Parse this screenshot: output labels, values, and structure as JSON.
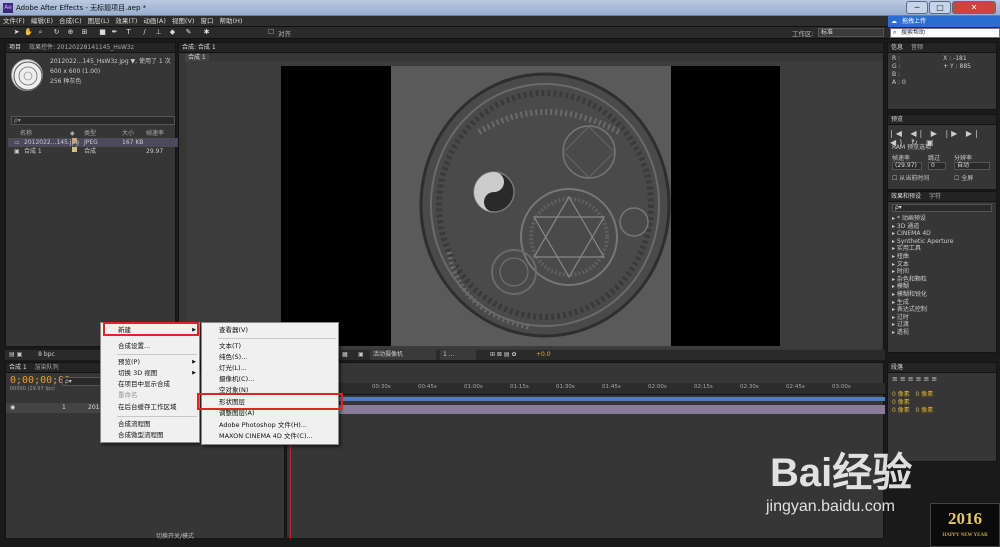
{
  "window": {
    "title": "Adobe After Effects - 无标题项目.aep *",
    "app_icon": "Ae",
    "minimize": "─",
    "maximize": "□",
    "close": "✕"
  },
  "menu": [
    "文件(F)",
    "编辑(E)",
    "合成(C)",
    "图层(L)",
    "效果(T)",
    "动画(A)",
    "视图(V)",
    "窗口",
    "帮助(H)"
  ],
  "upload_button": "拖拽上传",
  "toolbar": {
    "align_label": "对齐",
    "workspace_label": "工作区:",
    "workspace_value": "标准",
    "search_help": "搜索帮助"
  },
  "project": {
    "tab": "项目",
    "effects_tab": "效果控件: 20120228141145_HsW3z",
    "file_name": "2012022...145_HsW3z.jpg",
    "used": "▼, 使用了 1 次",
    "dims": "600 x 600 (1.00)",
    "colors": "256 种灰色",
    "search_placeholder": "ρ▾",
    "columns": [
      "名称",
      "类型",
      "大小",
      "帧速率"
    ],
    "rows": [
      {
        "name": "2012022...145.jpg",
        "type": "JPEG",
        "size": "167 KB",
        "fps": "",
        "color": "#c8a878"
      },
      {
        "name": "合成 1",
        "type": "合成",
        "size": "",
        "fps": "29.97",
        "color": "#d0c080"
      }
    ],
    "bpc": "8 bpc"
  },
  "viewer": {
    "tab": "合成: 合成 1",
    "sub_tab": "合成 1",
    "camera": "活动摄像机",
    "views": "1 ...",
    "exposure": "+0.0"
  },
  "timeline": {
    "tab": "合成 1",
    "render_tab": "渲染队列",
    "timecode": "0;00;00;00",
    "fps_note": "00000 (29.97 fps)",
    "search_placeholder": "ρ▾",
    "layer_index": "1",
    "layer_name": "2012",
    "ruler": [
      "00:30s",
      "00:45s",
      "01:00s",
      "01:15s",
      "01:30s",
      "01:45s",
      "02:00s",
      "02:15s",
      "02:30s",
      "02:45s",
      "03:00s"
    ],
    "footer": "切换开关/模式"
  },
  "info": {
    "tab1": "信息",
    "tab2": "音频",
    "rgba": [
      "R :",
      "G :",
      "B :",
      "A : 0"
    ],
    "x": "X : -181",
    "y": "+ Y : 885"
  },
  "preview": {
    "tab": "预览",
    "controls": "|◀ ◀| ▶ |▶ ▶| ◀) ↻ ▣",
    "ram": "RAM 预览选项",
    "frame_rate_label": "帧速率",
    "skip_label": "跳过",
    "resolution_label": "分辨率",
    "frame_rate": "(29.97)",
    "skip": "0",
    "resolution": "自动",
    "from_current": "从当前时间",
    "fullscreen": "全屏"
  },
  "effects": {
    "tab": "效果和预设",
    "tab2": "字符",
    "search_placeholder": "ρ▾",
    "items": [
      "* 动画预设",
      "3D 通道",
      "CINEMA 4D",
      "Synthetic Aperture",
      "实用工具",
      "扭曲",
      "文本",
      "时间",
      "杂色和颗粒",
      "模糊",
      "模糊和锐化",
      "生成",
      "表达式控制",
      "过时",
      "过渡",
      "透视"
    ]
  },
  "paragraph": {
    "tab": "段落",
    "px": [
      "0 像素",
      "0 像素",
      "0 像素",
      "0 像素",
      "0 像素"
    ]
  },
  "context_menu": {
    "items": [
      {
        "label": "新建",
        "submenu": true,
        "disabled": false
      },
      {
        "label": "合成设置...",
        "submenu": false,
        "disabled": false
      },
      {
        "label": "预览(P)",
        "submenu": true,
        "disabled": false
      },
      {
        "label": "切换 3D 视图",
        "submenu": true,
        "disabled": false
      },
      {
        "label": "在项目中显示合成",
        "submenu": false,
        "disabled": false
      },
      {
        "label": "重命名",
        "submenu": false,
        "disabled": true
      },
      {
        "label": "在后台缓存工作区域",
        "submenu": false,
        "disabled": false
      },
      {
        "label": "合成流程图",
        "submenu": false,
        "disabled": false
      },
      {
        "label": "合成微型流程图",
        "submenu": false,
        "disabled": false
      }
    ]
  },
  "submenu": {
    "items": [
      "查看器(V)",
      "文本(T)",
      "纯色(S)...",
      "灯光(L)...",
      "摄像机(C)...",
      "空对象(N)",
      "形状图层",
      "调整图层(A)",
      "Adobe Photoshop 文件(H)...",
      "MAXON CINEMA 4D 文件(C)..."
    ]
  },
  "watermark": {
    "brand": "Bai经验",
    "url": "jingyan.baidu.com"
  },
  "badge": {
    "year": "2016",
    "caption": "HAPPY NEW YEAR"
  }
}
